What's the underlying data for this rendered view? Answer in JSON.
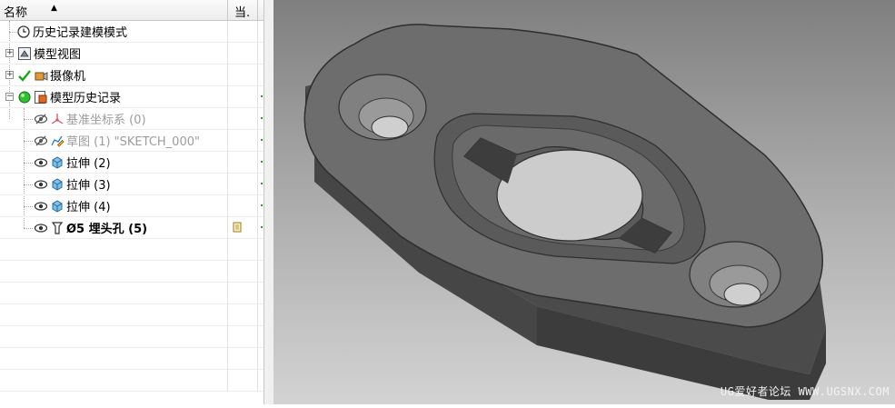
{
  "navigator": {
    "header": {
      "name_label": "名称",
      "sort_glyph": "▲",
      "current_label": "当."
    },
    "rows": [
      {
        "label": "历史记录建模模式",
        "icon": "clock-icon",
        "style": "normal"
      },
      {
        "label": "模型视图",
        "icon": "model-view-icon",
        "style": "normal",
        "expander": "+"
      },
      {
        "label": "摄像机",
        "icon": "camera-icon",
        "style": "normal",
        "expander": "+"
      },
      {
        "label": "模型历史记录",
        "icon": "model-history-icon",
        "style": "normal",
        "expander": "−"
      },
      {
        "label": "基准坐标系 (0)",
        "icon": "datum-csys-icon",
        "style": "muted"
      },
      {
        "label": "草图 (1) \"SKETCH_000\"",
        "icon": "sketch-icon",
        "style": "muted"
      },
      {
        "label": "拉伸 (2)",
        "icon": "extrude-icon",
        "style": "normal"
      },
      {
        "label": "拉伸 (3)",
        "icon": "extrude-icon",
        "style": "normal"
      },
      {
        "label": "拉伸 (4)",
        "icon": "extrude-icon",
        "style": "normal"
      },
      {
        "label": "Ø5 埋头孔 (5)",
        "icon": "countersink-hole-icon",
        "style": "bold"
      }
    ]
  },
  "viewport": {
    "watermark": "UG爱好者论坛 WWW.UGSNX.COM"
  },
  "colors": {
    "part_face": "#6e6e6e",
    "part_side": "#4a4a4a",
    "background_top": "#7f7f7f",
    "background_bottom": "#d3d3d3"
  }
}
